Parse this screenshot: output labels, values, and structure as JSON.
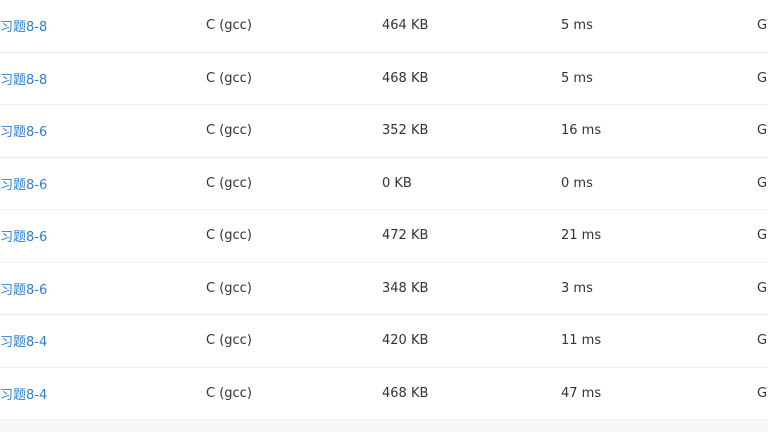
{
  "rows": [
    {
      "problem": "习题8-8",
      "language": "C (gcc)",
      "memory": "464 KB",
      "time": "5 ms",
      "extra": "Gl"
    },
    {
      "problem": "习题8-8",
      "language": "C (gcc)",
      "memory": "468 KB",
      "time": "5 ms",
      "extra": "Gl"
    },
    {
      "problem": "习题8-6",
      "language": "C (gcc)",
      "memory": "352 KB",
      "time": "16 ms",
      "extra": "Gl"
    },
    {
      "problem": "习题8-6",
      "language": "C (gcc)",
      "memory": "0 KB",
      "time": "0 ms",
      "extra": "Gl"
    },
    {
      "problem": "习题8-6",
      "language": "C (gcc)",
      "memory": "472 KB",
      "time": "21 ms",
      "extra": "Gl"
    },
    {
      "problem": "习题8-6",
      "language": "C (gcc)",
      "memory": "348 KB",
      "time": "3 ms",
      "extra": "Gl"
    },
    {
      "problem": "习题8-4",
      "language": "C (gcc)",
      "memory": "420 KB",
      "time": "11 ms",
      "extra": "Gl"
    },
    {
      "problem": "习题8-4",
      "language": "C (gcc)",
      "memory": "468 KB",
      "time": "47 ms",
      "extra": "Gl"
    }
  ],
  "colors": {
    "link": "#2f7fd1",
    "text": "#333333",
    "divider": "#ebeef2"
  }
}
